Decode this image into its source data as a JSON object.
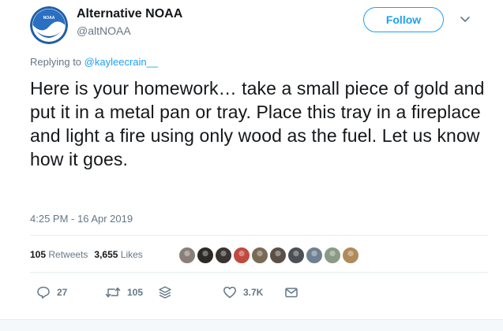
{
  "author": {
    "name": "Alternative NOAA",
    "handle": "@altNOAA",
    "avatar_icon": "noaa-logo-icon"
  },
  "follow_label": "Follow",
  "replying": {
    "prefix": "Replying to",
    "mention": "@kayleecrain__"
  },
  "tweet_text": "Here is your homework… take a small piece of gold and put it in a metal pan or tray. Place this tray in a fireplace and light a fire using only wood as the fuel. Let us know how it goes.",
  "timestamp": "4:25 PM - 16 Apr 2019",
  "stats": {
    "retweets_count": "105",
    "retweets_label": "Retweets",
    "likes_count": "3,655",
    "likes_label": "Likes"
  },
  "liker_avatar_colors": [
    "#8a7f78",
    "#2d2a26",
    "#3a3333",
    "#c04a3f",
    "#7a6a55",
    "#5b5048",
    "#4d4f55",
    "#6f8190",
    "#8a9a84",
    "#b08a5a"
  ],
  "actions": {
    "reply_count": "27",
    "retweet_count": "105",
    "like_count": "3.7K"
  },
  "colors": {
    "accent": "#1da1f2",
    "text": "#14171a",
    "muted": "#657786",
    "noaa_blue": "#1f5fa8"
  }
}
